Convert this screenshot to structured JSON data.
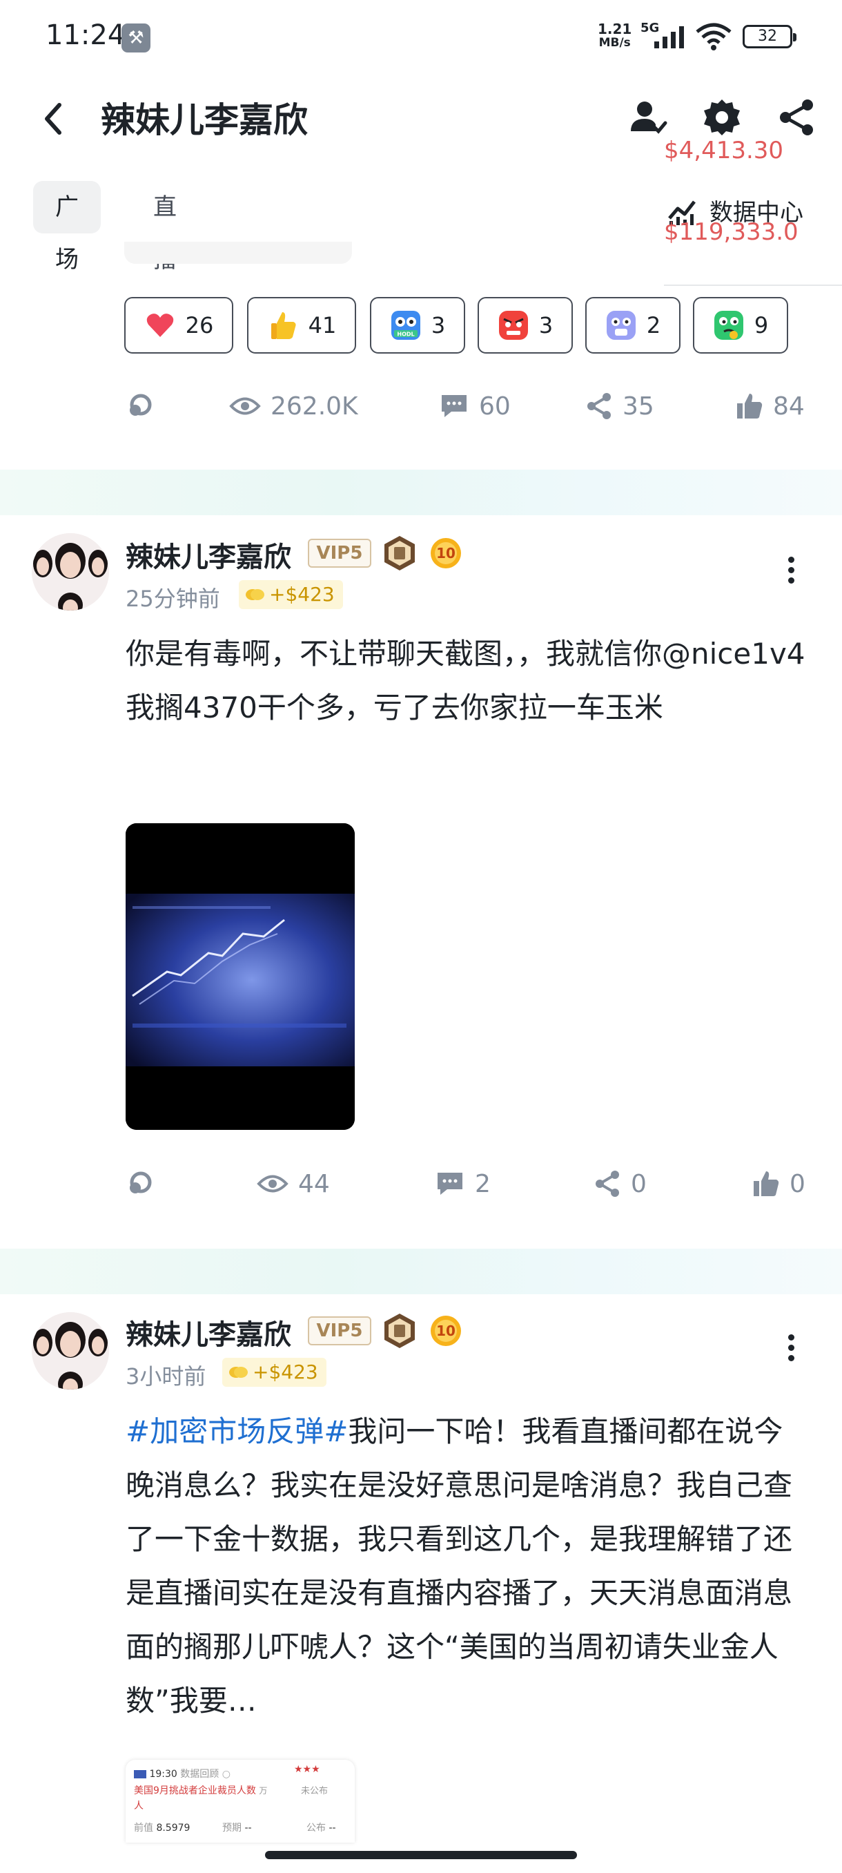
{
  "status_bar": {
    "time": "11:24",
    "net_speed_value": "1.21",
    "net_speed_unit": "MB/s",
    "network": "5G",
    "battery": "32"
  },
  "header": {
    "title": "辣妹儿李嘉欣",
    "price_top": "$4,413.30",
    "price_bottom": "$119,333.0",
    "data_center_label": "数据中心"
  },
  "tabs": [
    {
      "label": "广场",
      "active": true
    },
    {
      "label": "直播",
      "active": false
    }
  ],
  "previous_post": {
    "reactions": [
      {
        "icon": "heart-emoji-icon",
        "count": "26"
      },
      {
        "icon": "thumbs-up-emoji-icon",
        "count": "41"
      },
      {
        "icon": "hodl-emoji-icon",
        "count": "3"
      },
      {
        "icon": "angry-emoji-icon",
        "count": "3"
      },
      {
        "icon": "shocked-emoji-icon",
        "count": "2"
      },
      {
        "icon": "thinking-emoji-icon",
        "count": "9"
      }
    ],
    "stats": {
      "views": "262.0K",
      "comments": "60",
      "shares": "35",
      "likes": "84"
    }
  },
  "posts": [
    {
      "author": "辣妹儿李嘉欣",
      "vip": "VIP5",
      "level": "10",
      "time": "25分钟前",
      "tip": "+$423",
      "text": "你是有毒啊，不让带聊天截图，，我就信你@nice1v4我搁4370干个多，亏了去你家拉一车玉米",
      "stats": {
        "views": "44",
        "comments": "2",
        "shares": "0",
        "likes": "0"
      }
    },
    {
      "author": "辣妹儿李嘉欣",
      "vip": "VIP5",
      "level": "10",
      "time": "3小时前",
      "tip": "+$423",
      "hashtag": "#加密市场反弹#",
      "text": "我问一下哈！我看直播间都在说今晚消息么？我实在是没好意思问是啥消息？我自己查了一下金十数据，我只看到这几个，是我理解错了还是直播间实在是没有直播内容播了，天天消息面消息面的搁那儿吓唬人？这个“美国的当周初请失业金人数”我要…",
      "thumbnail": {
        "time": "19:30",
        "source": "数据回顾",
        "headline": "美国9月挑战者企业裁员人数",
        "headline_unit_a": "万",
        "headline_unit_b": "人",
        "status": "未公布",
        "prev_label": "前值",
        "prev_value": "8.5979",
        "forecast_label": "预期",
        "forecast_value": "--",
        "actual_label": "公布",
        "actual_value": "--"
      }
    }
  ],
  "colors": {
    "text": "#1e2329",
    "muted": "#848e9c",
    "price": "#e05a5a",
    "hashtag": "#1f6fd1",
    "tip_bg": "#fdf6d8",
    "tip_text": "#c99400"
  }
}
